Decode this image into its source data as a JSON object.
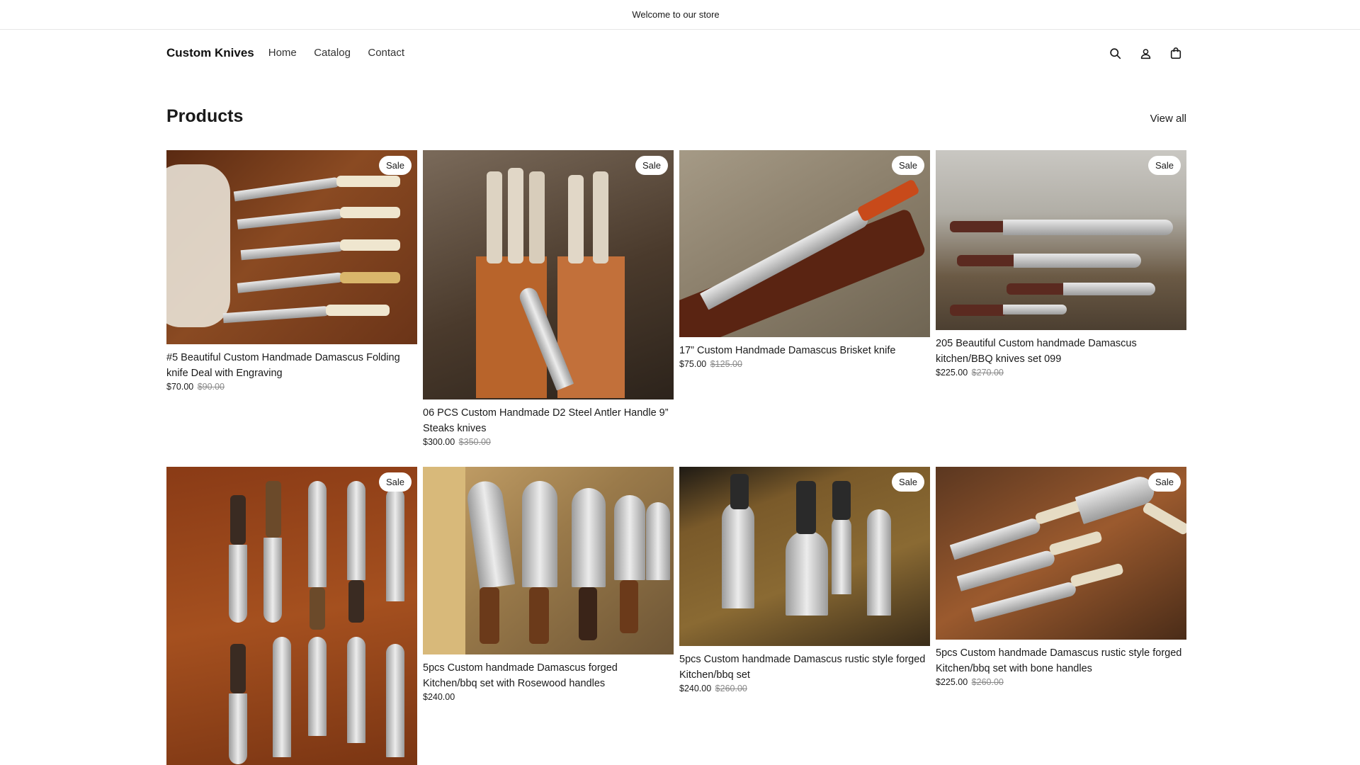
{
  "announcement": "Welcome to our store",
  "header": {
    "brand": "Custom Knives",
    "nav": [
      "Home",
      "Catalog",
      "Contact"
    ],
    "icons": [
      "search-icon",
      "account-icon",
      "cart-icon"
    ]
  },
  "section": {
    "title": "Products",
    "view_all": "View all"
  },
  "products": [
    {
      "title": "#5 Beautiful Custom Handmade Damascus Folding knife Deal with Engraving",
      "price": "$70.00",
      "compare": "$90.00",
      "badge": "Sale"
    },
    {
      "title": "06 PCS Custom Handmade D2 Steel Antler Handle 9” Steaks knives",
      "price": "$300.00",
      "compare": "$350.00",
      "badge": "Sale"
    },
    {
      "title": "17” Custom Handmade Damascus Brisket knife",
      "price": "$75.00",
      "compare": "$125.00",
      "badge": "Sale"
    },
    {
      "title": "205 Beautiful Custom handmade Damascus kitchen/BBQ knives set 099",
      "price": "$225.00",
      "compare": "$270.00",
      "badge": "Sale"
    },
    {
      "title": "",
      "price": "",
      "compare": "",
      "badge": "Sale"
    },
    {
      "title": "5pcs Custom handmade Damascus forged Kitchen/bbq set with Rosewood handles",
      "price": "$240.00",
      "compare": "",
      "badge": ""
    },
    {
      "title": "5pcs Custom handmade Damascus rustic style forged Kitchen/bbq set",
      "price": "$240.00",
      "compare": "$260.00",
      "badge": "Sale"
    },
    {
      "title": "5pcs Custom handmade Damascus rustic style forged Kitchen/bbq set with bone handles",
      "price": "$225.00",
      "compare": "$260.00",
      "badge": "Sale"
    }
  ],
  "colors": {
    "text": "#1a1a1a",
    "muted": "#8a8a8a",
    "border": "#e6e6e6"
  }
}
